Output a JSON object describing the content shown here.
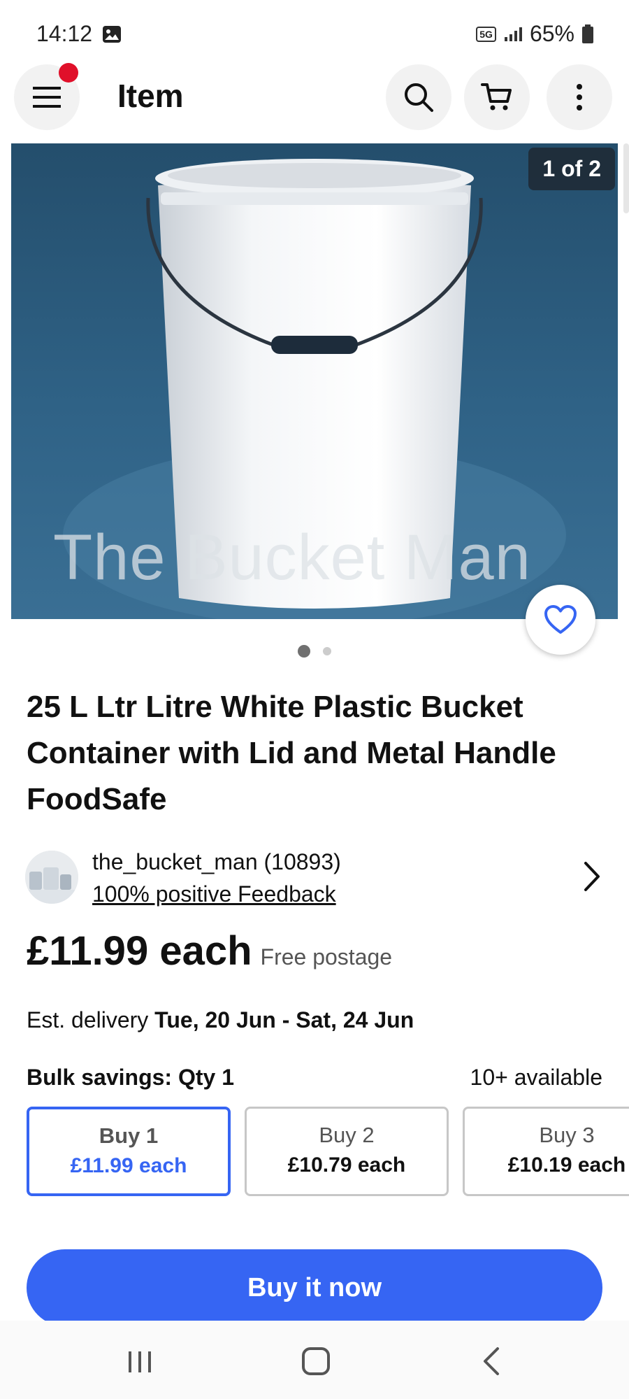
{
  "status_bar": {
    "time": "14:12",
    "network": "5G",
    "battery": "65%"
  },
  "app_bar": {
    "title": "Item",
    "icons": [
      "menu-icon",
      "search-icon",
      "cart-icon",
      "more-vert-icon"
    ]
  },
  "gallery": {
    "counter": "1 of 2",
    "image_watermark": "The Bucket Man",
    "active_index": 0,
    "count": 2
  },
  "item": {
    "title": "25 L Ltr Litre White Plastic Bucket Container with Lid and Metal Handle FoodSafe"
  },
  "seller": {
    "name": "the_bucket_man (10893)",
    "feedback": "100% positive Feedback"
  },
  "price": {
    "amount": "£11.99 each",
    "postage": "Free postage"
  },
  "delivery": {
    "label": "Est. delivery",
    "dates": "Tue, 20 Jun - Sat, 24 Jun"
  },
  "bulk": {
    "label": "Bulk savings: Qty 1",
    "available": "10+ available",
    "options": [
      {
        "qty": "Buy 1",
        "price": "£11.99 each"
      },
      {
        "qty": "Buy 2",
        "price": "£10.79 each"
      },
      {
        "qty": "Buy 3",
        "price": "£10.19 each"
      }
    ]
  },
  "actions": {
    "buy_now": "Buy it now"
  },
  "colors": {
    "accent": "#3665f3",
    "notification": "#e0102a"
  }
}
